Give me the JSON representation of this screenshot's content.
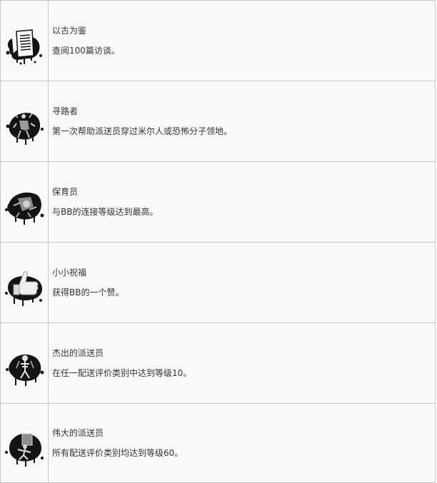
{
  "achievements": [
    {
      "icon": "document-icon",
      "title": "以古为鉴",
      "description": "查阅100篇访谈。"
    },
    {
      "icon": "pathfinder-figure-icon",
      "title": "寻路者",
      "description": "第一次帮助派送员穿过米尔人或恐怖分子领地。"
    },
    {
      "icon": "nursery-figure-icon",
      "title": "保育员",
      "description": "与BB的连接等级达到最高。"
    },
    {
      "icon": "thumbs-up-icon",
      "title": "小小祝福",
      "description": "获得BB的一个赞。"
    },
    {
      "icon": "skeleton-figure-icon",
      "title": "杰出的派送员",
      "description": "在任一配送评价类别中达到等级10。"
    },
    {
      "icon": "running-porter-icon",
      "title": "伟大的派送员",
      "description": "所有配送评价类别均达到等级60。"
    }
  ],
  "colors": {
    "cell_background": "#f9f9f9",
    "border": "#c8c8c8",
    "text": "#333333",
    "icon_ink": "#141414"
  }
}
